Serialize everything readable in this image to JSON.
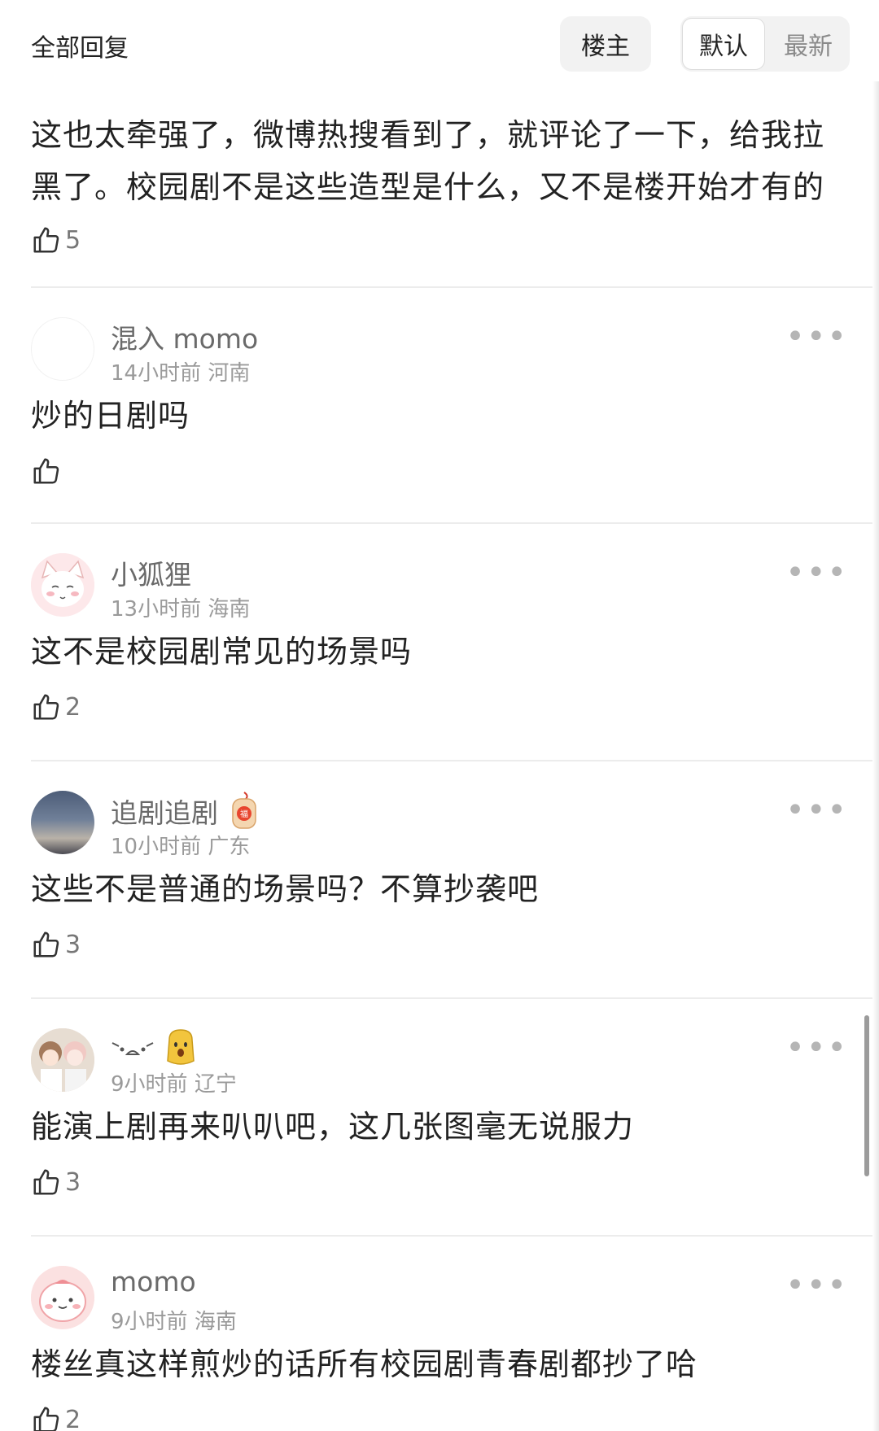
{
  "header": {
    "title": "全部回复",
    "owner_filter": "楼主",
    "sort_default": "默认",
    "sort_latest": "最新"
  },
  "first_comment": {
    "text": "这也太牵强了，微博热搜看到了，就评论了一下，给我拉黑了。校园剧不是这些造型是什么，又不是楼开始才有的",
    "likes": "5"
  },
  "comments": [
    {
      "name": "混入 momo",
      "time": "14小时前",
      "location": "河南",
      "text": "炒的日剧吗",
      "likes": ""
    },
    {
      "name": "小狐狸",
      "time": "13小时前",
      "location": "海南",
      "text": "这不是校园剧常见的场景吗",
      "likes": "2"
    },
    {
      "name": "追剧追剧",
      "time": "10小时前",
      "location": "广东",
      "text": "这些不是普通的场景吗？不算抄袭吧",
      "likes": "3"
    },
    {
      "name": "",
      "time": "9小时前",
      "location": "辽宁",
      "text": "能演上剧再来叭叭吧，这几张图毫无说服力",
      "likes": "3"
    },
    {
      "name": "momo",
      "time": "9小时前",
      "location": "海南",
      "text": "楼丝真这样煎炒的话所有校园剧青春剧都抄了哈",
      "likes": "2"
    }
  ],
  "icons": {
    "like": "thumbs-up-icon",
    "more": "more-dots-icon"
  },
  "colors": {
    "segment_bg": "#f2f2f2",
    "text_primary": "#222222",
    "text_secondary": "#9a9a9a",
    "divider": "#ececec"
  }
}
